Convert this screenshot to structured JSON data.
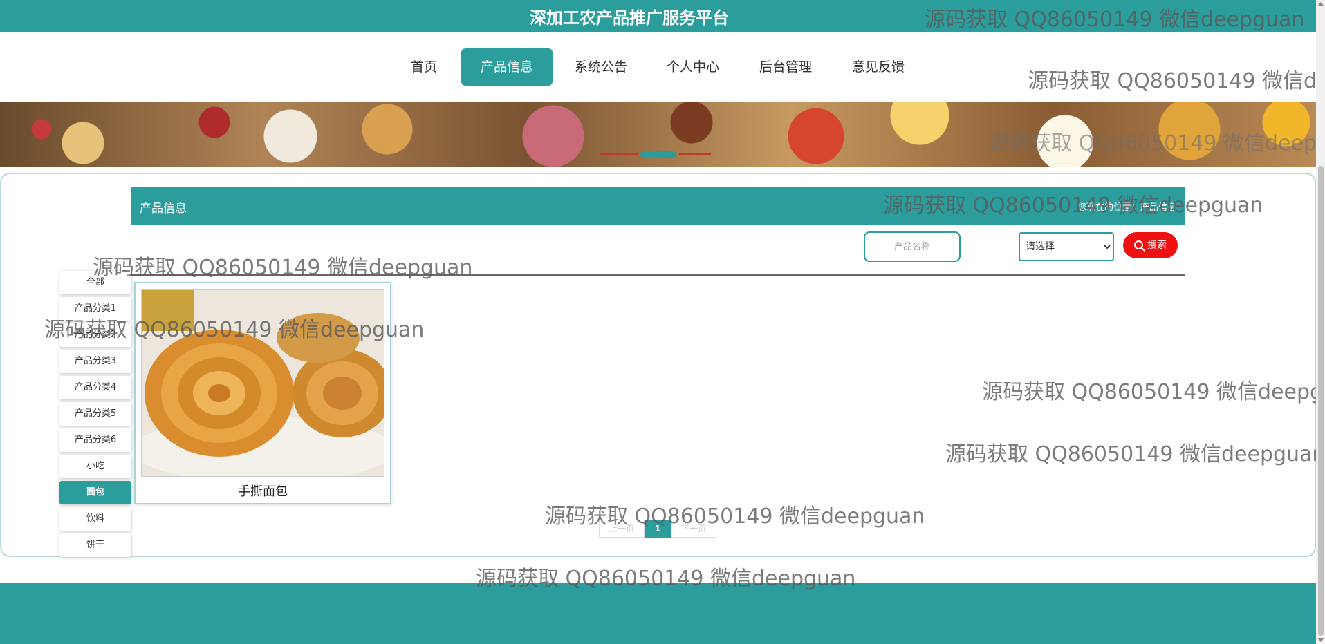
{
  "site": {
    "title": "深加工农产品推广服务平台"
  },
  "nav": {
    "items": [
      {
        "label": "首页"
      },
      {
        "label": "产品信息"
      },
      {
        "label": "系统公告"
      },
      {
        "label": "个人中心"
      },
      {
        "label": "后台管理"
      },
      {
        "label": "意见反馈"
      }
    ],
    "active_index": 1
  },
  "section": {
    "title": "产品信息",
    "breadcrumb": "您现在的位置：产品信息"
  },
  "search": {
    "placeholder": "产品名称",
    "select_value": "请选择",
    "button_label": "搜索"
  },
  "categories": {
    "items": [
      "全部",
      "产品分类1",
      "产品分类2",
      "产品分类3",
      "产品分类4",
      "产品分类5",
      "产品分类6",
      "小吃",
      "面包",
      "饮料",
      "饼干"
    ],
    "active": "面包"
  },
  "products": [
    {
      "name": "手撕面包"
    }
  ],
  "pagination": {
    "prev_label": "上一页",
    "current_page": "1",
    "next_label": "下一页"
  },
  "watermark": {
    "text": "源码获取 QQ86050149 微信deepguan"
  },
  "colors": {
    "primary": "#2a9d9c",
    "search_button": "#ee1111"
  }
}
